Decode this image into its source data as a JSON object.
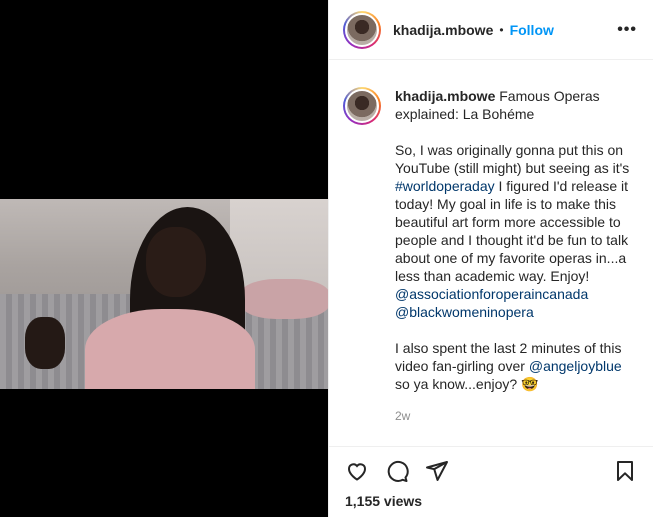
{
  "header": {
    "username": "khadija.mbowe",
    "separator": "•",
    "follow_label": "Follow",
    "more_label": "•••"
  },
  "caption": {
    "username": "khadija.mbowe",
    "title": "Famous Operas explained: La Bohéme",
    "para1_a": "So, I was originally gonna put this on YouTube (still might) but seeing as it's ",
    "hashtag": "#worldoperaday",
    "para1_b": " I figured I'd release it today! My goal in life is to make this beautiful art form more accessible to people and I thought it'd be fun to talk about one of my favorite operas in...a less than academic way. Enjoy!",
    "mention1": "@associationforoperaincanada",
    "mention2": "@blackwomeninopera",
    "para2_a": "I also spent the last 2 minutes of this video fan-girling over ",
    "mention3": "@angeljoyblue",
    "para2_b": " so ya know...enjoy? 🤓",
    "time": "2w"
  },
  "actions": {
    "icons": [
      "heart-icon",
      "comment-icon",
      "share-icon",
      "bookmark-icon"
    ],
    "views": "1,155 views"
  },
  "colors": {
    "accent": "#0095f6",
    "link": "#00376b",
    "text": "#262626",
    "muted": "#8e8e8e",
    "border": "#efefef"
  }
}
